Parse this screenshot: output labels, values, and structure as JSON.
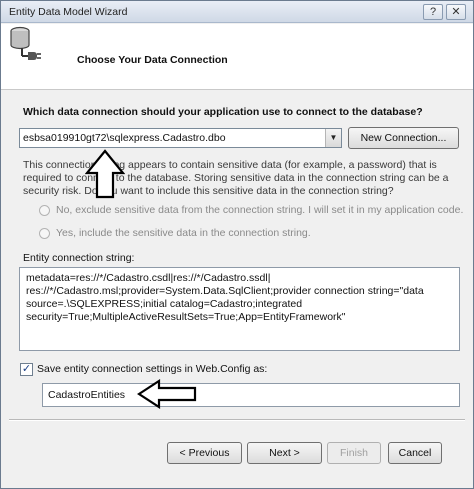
{
  "window": {
    "title": "Entity Data Model Wizard",
    "help_button": "?",
    "close_button": "✕"
  },
  "header": {
    "heading": "Choose Your Data Connection"
  },
  "main": {
    "question": "Which data connection should your application use to connect to the database?",
    "connection_select": {
      "selected": "esbsa019910gt72\\sqlexpress.Cadastro.dbo"
    },
    "new_connection_button": "New Connection...",
    "sensitive_paragraph": [
      "This connection string appears to contain sensitive data (for example, a password) that is",
      "required to connect to the database. Storing sensitive data in the connection string can be a",
      "security risk. Do you want to include this sensitive data in the connection string?"
    ],
    "radio_exclude": "No, exclude sensitive data from the connection string. I will set it in my application code.",
    "radio_include": "Yes, include the sensitive data in the connection string.",
    "entity_connection_label": "Entity connection string:",
    "entity_connection_lines": [
      "metadata=res://*/Cadastro.csdl|res://*/Cadastro.ssdl|",
      "res://*/Cadastro.msl;provider=System.Data.SqlClient;provider connection string=\"data",
      "source=.\\SQLEXPRESS;initial catalog=Cadastro;integrated",
      "security=True;MultipleActiveResultSets=True;App=EntityFramework\""
    ],
    "save_checkbox": {
      "checked": true,
      "label": "Save entity connection settings in Web.Config as:"
    },
    "entity_name_value": "CadastroEntities"
  },
  "footer": {
    "previous_button": "< Previous",
    "next_button": "Next >",
    "finish_button": "Finish",
    "cancel_button": "Cancel"
  },
  "colors": {
    "dialog_bg": "#f0f0f0",
    "header_bg": "#ffffff",
    "disabled_text": "#8a8a8a"
  }
}
